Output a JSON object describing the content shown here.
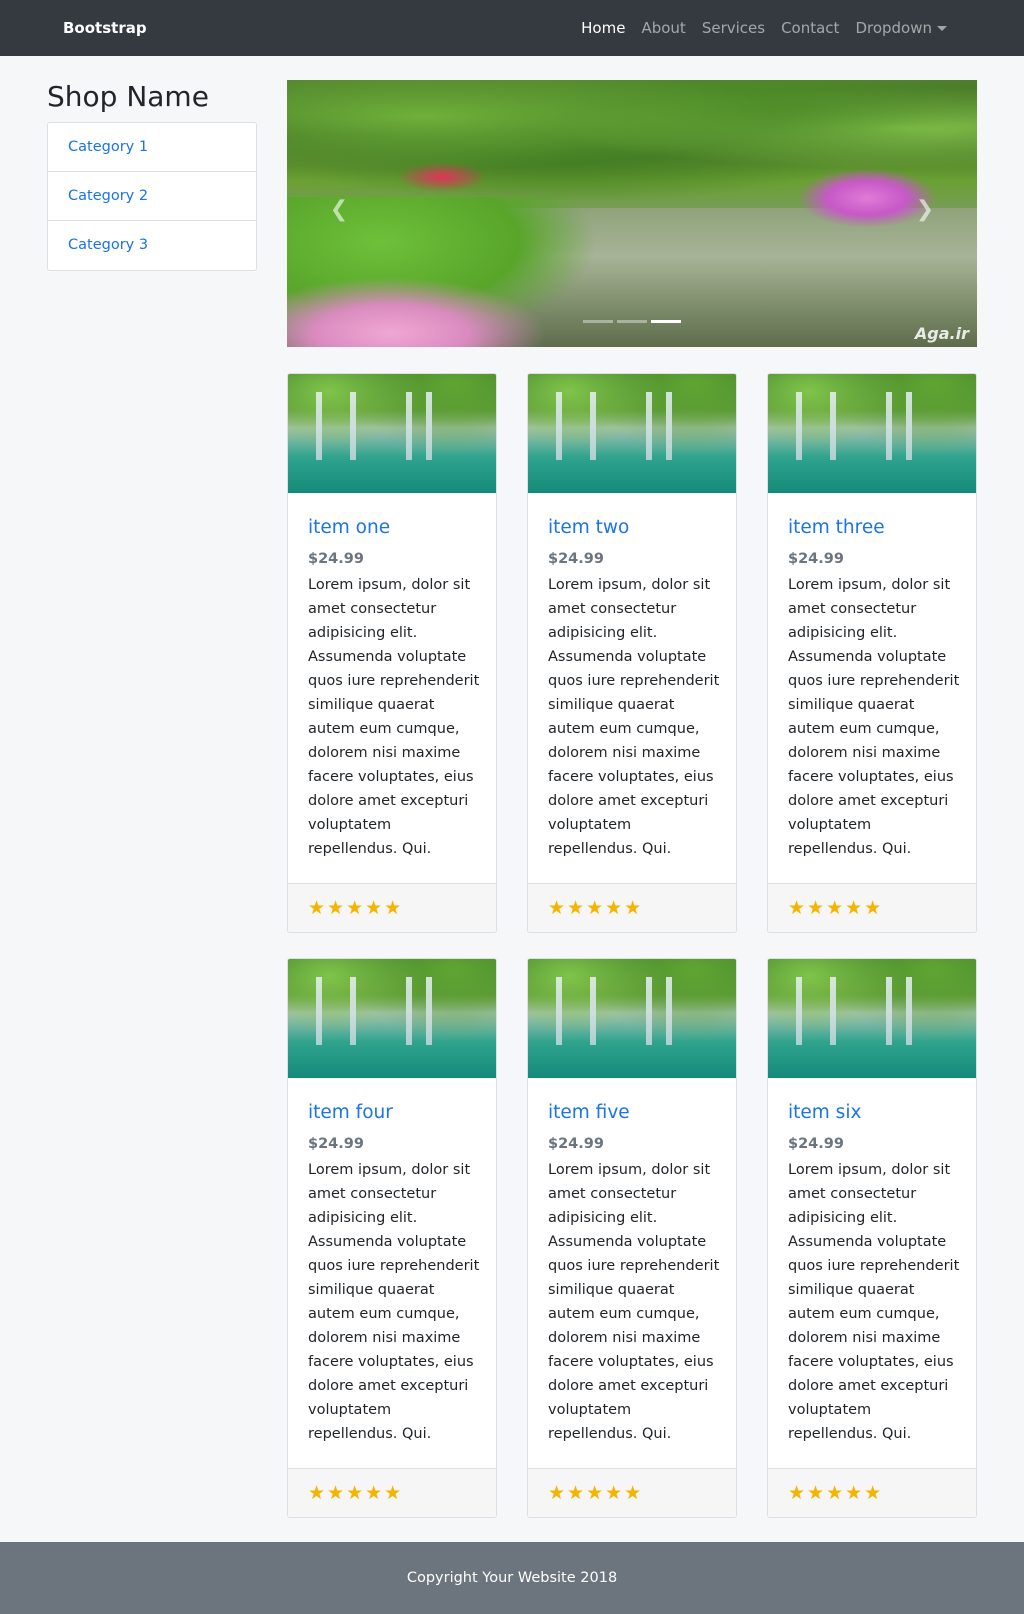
{
  "navbar": {
    "brand": "Bootstrap",
    "links": [
      {
        "label": "Home",
        "active": true
      },
      {
        "label": "About"
      },
      {
        "label": "Services"
      },
      {
        "label": "Contact"
      },
      {
        "label": "Dropdown"
      }
    ]
  },
  "sidebar": {
    "title": "Shop Name",
    "categories": [
      "Category 1",
      "Category 2",
      "Category 3"
    ]
  },
  "carousel": {
    "prev_icon": "chevron-left-icon",
    "next_icon": "chevron-right-icon",
    "slide_count": 3,
    "active_slide": 3,
    "watermark": "Aga.ir"
  },
  "cards": [
    {
      "title": "item one",
      "price": "$24.99",
      "text": "Lorem ipsum, dolor sit amet consectetur adipisicing elit. Assumenda voluptate quos iure reprehenderit similique quaerat autem eum cumque, dolorem nisi maxime facere voluptates, eius dolore amet excepturi voluptatem repellendus. Qui.",
      "rating": 5,
      "stars": "★★★★★"
    },
    {
      "title": "item two",
      "price": "$24.99",
      "text": "Lorem ipsum, dolor sit amet consectetur adipisicing elit. Assumenda voluptate quos iure reprehenderit similique quaerat autem eum cumque, dolorem nisi maxime facere voluptates, eius dolore amet excepturi voluptatem repellendus. Qui.",
      "rating": 5,
      "stars": "★★★★★"
    },
    {
      "title": "item three",
      "price": "$24.99",
      "text": "Lorem ipsum, dolor sit amet consectetur adipisicing elit. Assumenda voluptate quos iure reprehenderit similique quaerat autem eum cumque, dolorem nisi maxime facere voluptates, eius dolore amet excepturi voluptatem repellendus. Qui.",
      "rating": 5,
      "stars": "★★★★★"
    },
    {
      "title": "item four",
      "price": "$24.99",
      "text": "Lorem ipsum, dolor sit amet consectetur adipisicing elit. Assumenda voluptate quos iure reprehenderit similique quaerat autem eum cumque, dolorem nisi maxime facere voluptates, eius dolore amet excepturi voluptatem repellendus. Qui.",
      "rating": 5,
      "stars": "★★★★★"
    },
    {
      "title": "item five",
      "price": "$24.99",
      "text": "Lorem ipsum, dolor sit amet consectetur adipisicing elit. Assumenda voluptate quos iure reprehenderit similique quaerat autem eum cumque, dolorem nisi maxime facere voluptates, eius dolore amet excepturi voluptatem repellendus. Qui.",
      "rating": 5,
      "stars": "★★★★★"
    },
    {
      "title": "item six",
      "price": "$24.99",
      "text": "Lorem ipsum, dolor sit amet consectetur adipisicing elit. Assumenda voluptate quos iure reprehenderit similique quaerat autem eum cumque, dolorem nisi maxime facere voluptates, eius dolore amet excepturi voluptatem repellendus. Qui.",
      "rating": 5,
      "stars": "★★★★★"
    }
  ],
  "colors": {
    "navbar_bg": "#343a40",
    "link": "#1a73e8",
    "star": "#f5b400",
    "footer_bg": "#6c757d"
  },
  "footer": {
    "copyright": "Copyright Your Website 2018"
  }
}
